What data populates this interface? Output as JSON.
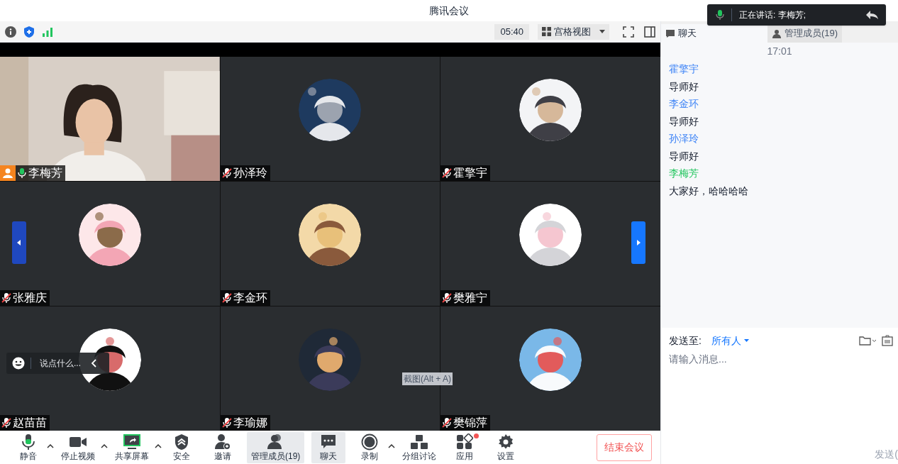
{
  "window": {
    "title": "腾讯会议"
  },
  "topbar": {
    "timer": "05:40",
    "view_mode": "宫格视图"
  },
  "speaker_toast": {
    "label": "正在讲话: 李梅芳;"
  },
  "participants": [
    {
      "name": "李梅芳",
      "kind": "video",
      "muted": false,
      "self": true
    },
    {
      "name": "孙泽玲",
      "kind": "avatar",
      "muted": true,
      "self": false
    },
    {
      "name": "霍擎宇",
      "kind": "avatar",
      "muted": true,
      "self": false
    },
    {
      "name": "张雅庆",
      "kind": "avatar",
      "muted": true,
      "self": false
    },
    {
      "name": "李金环",
      "kind": "avatar",
      "muted": true,
      "self": false
    },
    {
      "name": "樊雅宁",
      "kind": "avatar",
      "muted": true,
      "self": false
    },
    {
      "name": "赵苗苗",
      "kind": "avatar",
      "muted": true,
      "self": false
    },
    {
      "name": "李瑜娜",
      "kind": "avatar",
      "muted": true,
      "self": false
    },
    {
      "name": "樊锦萍",
      "kind": "avatar",
      "muted": true,
      "self": false
    }
  ],
  "quick_comment": {
    "placeholder": "说点什么..."
  },
  "screenshot_tooltip": "截图(Alt + A)",
  "toolbar": [
    {
      "kind": "mic",
      "label": "静音",
      "caret": true,
      "selected": false,
      "badge": false
    },
    {
      "kind": "camera",
      "label": "停止视频",
      "caret": true,
      "selected": false,
      "badge": false
    },
    {
      "kind": "share",
      "label": "共享屏幕",
      "caret": true,
      "selected": false,
      "badge": false
    },
    {
      "kind": "shield",
      "label": "安全",
      "caret": false,
      "selected": false,
      "badge": false
    },
    {
      "kind": "invite",
      "label": "邀请",
      "caret": false,
      "selected": false,
      "badge": false
    },
    {
      "kind": "members",
      "label": "管理成员(19)",
      "caret": false,
      "selected": true,
      "badge": false
    },
    {
      "kind": "chat",
      "label": "聊天",
      "caret": false,
      "selected": true,
      "badge": false
    },
    {
      "kind": "record",
      "label": "录制",
      "caret": true,
      "selected": false,
      "badge": false
    },
    {
      "kind": "breakout",
      "label": "分组讨论",
      "caret": false,
      "selected": false,
      "badge": false
    },
    {
      "kind": "apps",
      "label": "应用",
      "caret": false,
      "selected": false,
      "badge": true
    },
    {
      "kind": "settings",
      "label": "设置",
      "caret": false,
      "selected": false,
      "badge": false
    }
  ],
  "end_button": "结束会议",
  "side_panel": {
    "tabs": [
      {
        "label": "聊天",
        "selected": true
      },
      {
        "label": "管理成员(19)",
        "selected": false
      }
    ],
    "time": "17:01",
    "messages": [
      {
        "sender": "霍擎宇",
        "color": "#3b82f6",
        "text": "导师好"
      },
      {
        "sender": "李金环",
        "color": "#3b82f6",
        "text": "导师好"
      },
      {
        "sender": "孙泽玲",
        "color": "#3b82f6",
        "text": "导师好"
      },
      {
        "sender": "李梅芳",
        "color": "#22c55e",
        "text": "大家好，哈哈哈哈"
      }
    ],
    "send_to_label": "发送至:",
    "recipient": "所有人",
    "input_placeholder": "请输入消息...",
    "send_button": "发送("
  }
}
